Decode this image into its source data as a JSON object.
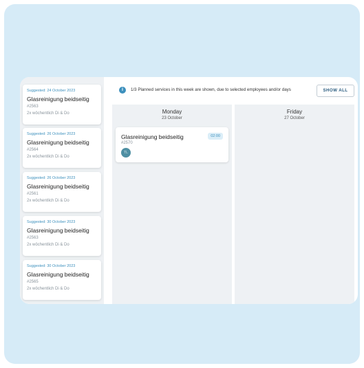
{
  "sidebar": {
    "suggestions": [
      {
        "date": "Suggested: 24 October 2023",
        "title": "Glasreinigung beidseitig",
        "id": "#2563",
        "frequency": "2x wöchentlich Di & Do"
      },
      {
        "date": "Suggested: 26 October 2023",
        "title": "Glasreinigung beidseitig",
        "id": "#2564",
        "frequency": "2x wöchentlich Di & Do"
      },
      {
        "date": "Suggested: 26 October 2023",
        "title": "Glasreinigung beidseitig",
        "id": "#2561",
        "frequency": "2x wöchentlich Di & Do"
      },
      {
        "date": "Suggested: 30 October 2023",
        "title": "Glasreinigung beidseitig",
        "id": "#2563",
        "frequency": "2x wöchentlich Di & Do"
      },
      {
        "date": "Suggested: 30 October 2023",
        "title": "Glasreinigung beidseitig",
        "id": "#2565",
        "frequency": "2x wöchentlich Di & Do"
      }
    ]
  },
  "info": {
    "icon": "info-icon",
    "icon_glyph": "i",
    "text": "1/3 Planned services in this week are shown, due to selected employees and/or days",
    "show_all_label": "SHOW ALL"
  },
  "days": [
    {
      "name": "Monday",
      "date": "23 October"
    },
    {
      "name": "Friday",
      "date": "27 October"
    }
  ],
  "service": {
    "title": "Glasreinigung beidseitig",
    "id": "#2570",
    "time": "02:00",
    "avatar_initials": "TL"
  },
  "colors": {
    "background": "#d6ebf7",
    "accent": "#3d90bd",
    "column": "#eef1f4",
    "avatar": "#4f8fa3"
  }
}
